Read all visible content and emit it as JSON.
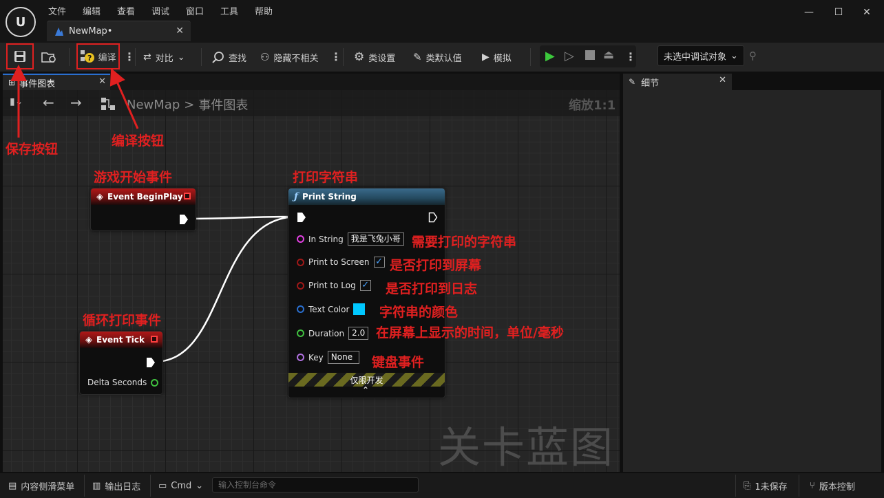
{
  "menubar": {
    "items": [
      "文件",
      "编辑",
      "查看",
      "调试",
      "窗口",
      "工具",
      "帮助"
    ]
  },
  "document_tab": {
    "label": "NewMap•"
  },
  "toolbar": {
    "compile_label": "编译",
    "compare_label": "对比",
    "find_label": "查找",
    "hide_unrelated_label": "隐藏不相关",
    "class_settings_label": "类设置",
    "class_defaults_label": "类默认值",
    "simulate_label": "模拟",
    "debug_object_label": "未选中调试对象"
  },
  "graph_panel": {
    "tab_label": "事件图表",
    "breadcrumb": [
      "NewMap",
      "事件图表"
    ],
    "breadcrumb_sep": ">",
    "zoom_label": "缩放1:1",
    "watermark": "关卡蓝图"
  },
  "details_panel": {
    "tab_label": "细节"
  },
  "nodes": {
    "begin_play": {
      "title": "Event BeginPlay"
    },
    "tick": {
      "title": "Event Tick",
      "delta_label": "Delta Seconds"
    },
    "print_string": {
      "title": "Print String",
      "in_string_label": "In String",
      "in_string_value": "我是飞兔小哥",
      "print_to_screen_label": "Print to Screen",
      "print_to_log_label": "Print to Log",
      "text_color_label": "Text Color",
      "text_color_value": "#00c8ff",
      "duration_label": "Duration",
      "duration_value": "2.0",
      "key_label": "Key",
      "key_value": "None",
      "dev_only_label": "仅限开发"
    }
  },
  "annotations": {
    "save_button": "保存按钮",
    "compile_button": "编译按钮",
    "begin_play": "游戏开始事件",
    "print_string": "打印字符串",
    "tick": "循环打印事件",
    "in_string": "需要打印的字符串",
    "print_to_screen": "是否打印到屏幕",
    "print_to_log": "是否打印到日志",
    "text_color": "字符串的颜色",
    "duration": "在屏幕上显示的时间，单位/毫秒",
    "key": "键盘事件"
  },
  "statusbar": {
    "content_drawer_label": "内容侧滑菜单",
    "output_log_label": "输出日志",
    "cmd_label": "Cmd",
    "cmd_placeholder": "输入控制台命令",
    "unsaved_label": "1未保存",
    "source_control_label": "版本控制"
  },
  "colors": {
    "annotation_red": "#e02020",
    "exec_pin": "#ffffff",
    "string_pin": "#e040e0",
    "bool_pin": "#a01818",
    "color_pin": "#2a6fd0",
    "float_pin": "#40c040",
    "key_pin": "#b070e0"
  }
}
